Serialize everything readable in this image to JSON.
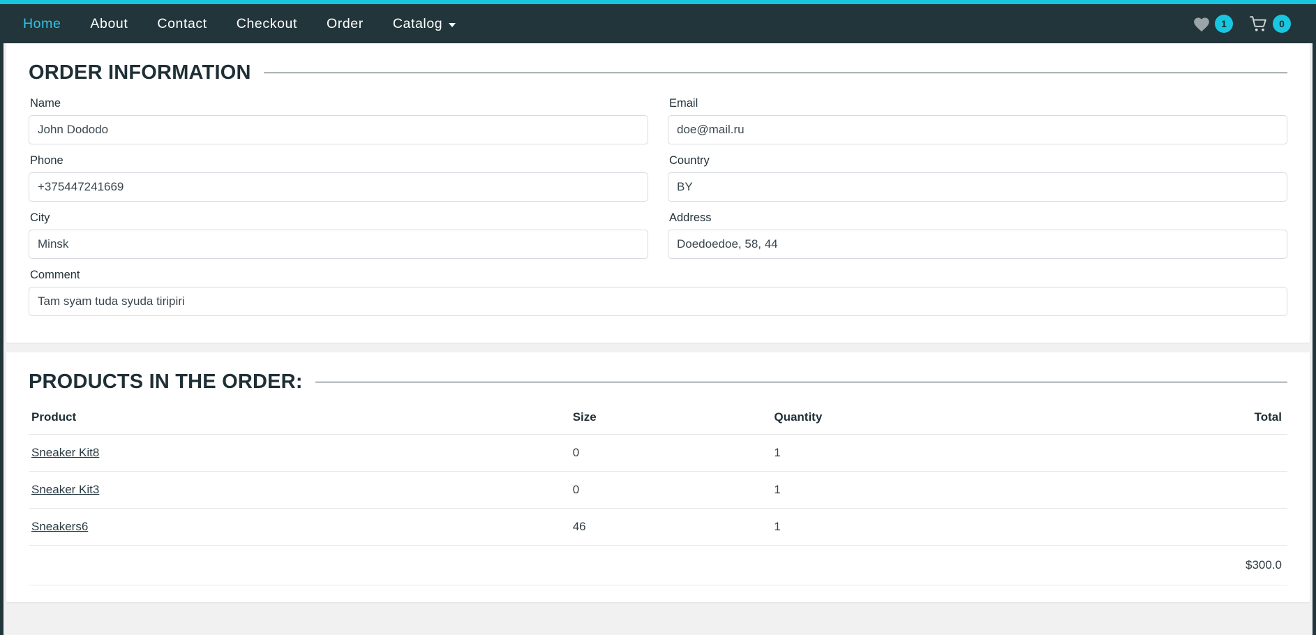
{
  "theme": {
    "accent": "#19c6e0",
    "navbar_bg": "#22353a",
    "page_bg": "#f1f1f1",
    "card_bg": "#ffffff",
    "text": "#1f2f36"
  },
  "navbar": {
    "links": [
      {
        "label": "Home",
        "active": true
      },
      {
        "label": "About",
        "active": false
      },
      {
        "label": "Contact",
        "active": false
      },
      {
        "label": "Checkout",
        "active": false
      },
      {
        "label": "Order",
        "active": false
      },
      {
        "label": "Catalog",
        "active": false,
        "has_caret": true
      }
    ],
    "wishlist": {
      "icon": "heart-icon",
      "count": "1"
    },
    "cart": {
      "icon": "cart-icon",
      "count": "0"
    }
  },
  "order_information": {
    "heading": "ORDER INFORMATION",
    "fields": {
      "name": {
        "label": "Name",
        "value": "John Dododo",
        "placeholder": "Name"
      },
      "email": {
        "label": "Email",
        "value": "doe@mail.ru",
        "placeholder": "Email"
      },
      "phone": {
        "label": "Phone",
        "value": "+375447241669",
        "placeholder": "Phone"
      },
      "country": {
        "label": "Country",
        "value": "BY",
        "placeholder": "Country"
      },
      "city": {
        "label": "City",
        "value": "Minsk",
        "placeholder": "City"
      },
      "address": {
        "label": "Address",
        "value": "Doedoedoe, 58, 44",
        "placeholder": "Address"
      },
      "comment": {
        "label": "Comment",
        "value": "Tam syam tuda syuda tiripiri",
        "placeholder": "Comment"
      }
    }
  },
  "products_section": {
    "heading": "PRODUCTS IN THE ORDER:",
    "columns": [
      "Product",
      "Size",
      "Quantity",
      "Total"
    ],
    "rows": [
      {
        "product": "Sneaker Kit8",
        "size": "0",
        "quantity": "1",
        "total": ""
      },
      {
        "product": "Sneaker Kit3",
        "size": "0",
        "quantity": "1",
        "total": ""
      },
      {
        "product": "Sneakers6",
        "size": "46",
        "quantity": "1",
        "total": ""
      }
    ],
    "grand_total": "$300.0"
  }
}
